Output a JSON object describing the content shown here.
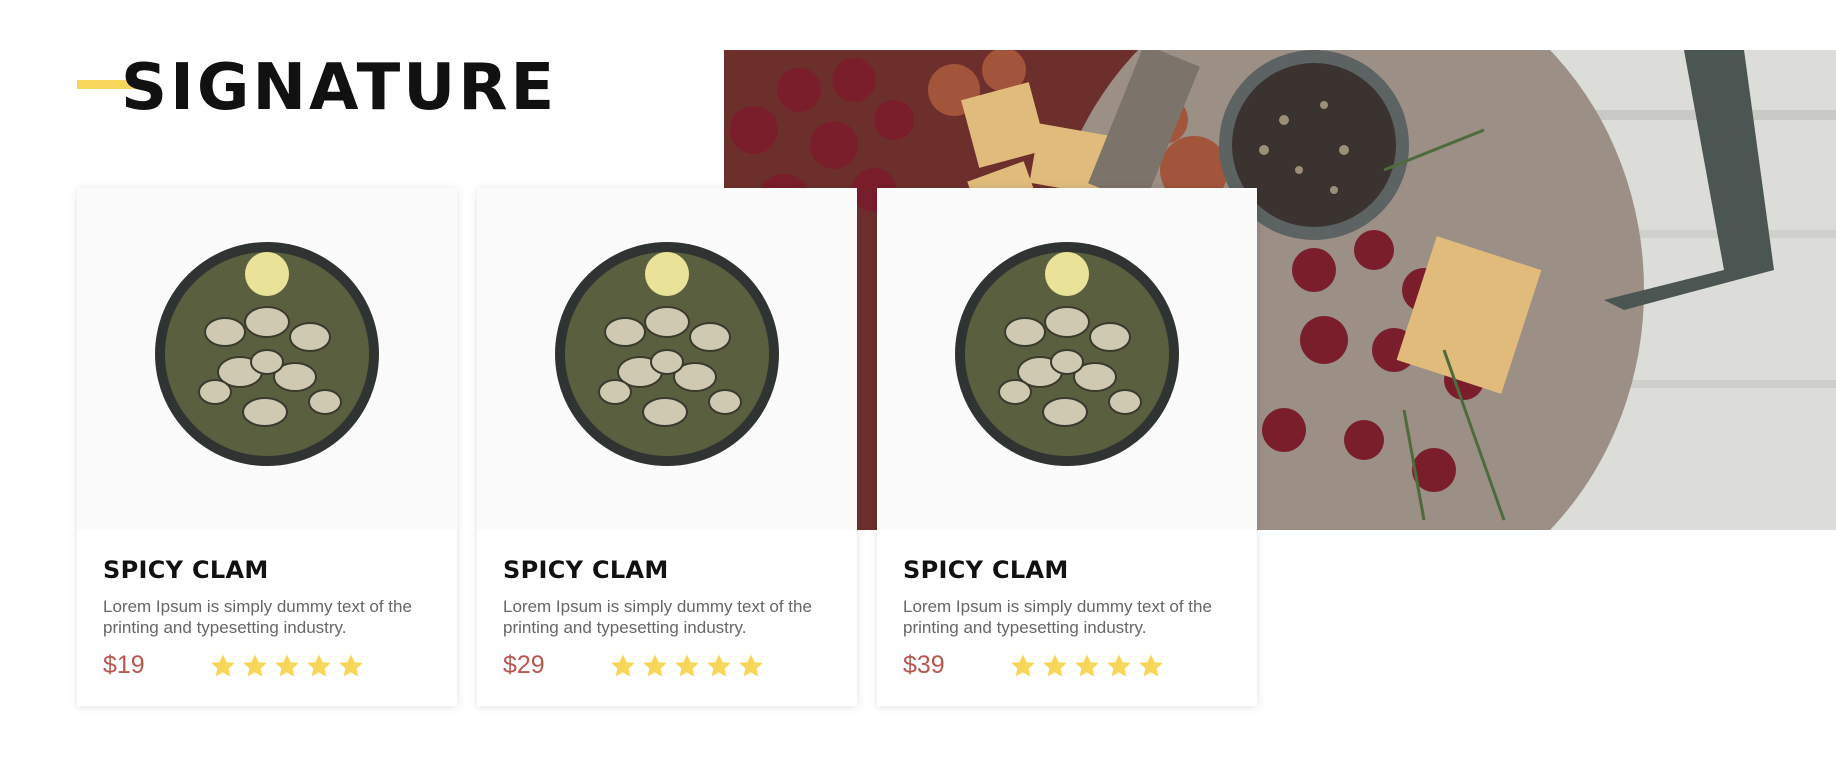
{
  "section": {
    "title": "SIGNATURE",
    "accent_color": "#f8d75c",
    "hero_image": "charcuterie-board-image"
  },
  "cards": [
    {
      "name": "SPICY CLAM",
      "description": "Lorem Ipsum is simply dummy text of the printing and typesetting industry.",
      "price": "$19",
      "rating": 5,
      "image": "clam-bowl-image"
    },
    {
      "name": "SPICY CLAM",
      "description": "Lorem Ipsum is simply dummy text of the printing and typesetting industry.",
      "price": "$29",
      "rating": 5,
      "image": "clam-bowl-image"
    },
    {
      "name": "SPICY CLAM",
      "description": "Lorem Ipsum is simply dummy text of the printing and typesetting industry.",
      "price": "$39",
      "rating": 5,
      "image": "clam-bowl-image"
    }
  ],
  "colors": {
    "price": "#b7584f",
    "star": "#f8d75c"
  }
}
